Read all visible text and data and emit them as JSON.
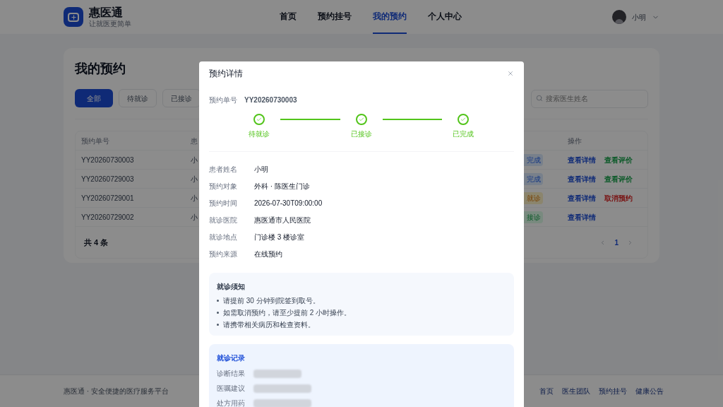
{
  "header": {
    "brand": "惠医通",
    "slogan": "让就医更简单",
    "nav": [
      {
        "label": "首页",
        "selected": false
      },
      {
        "label": "预约挂号",
        "selected": false
      },
      {
        "label": "我的预约",
        "selected": true
      },
      {
        "label": "个人中心",
        "selected": false
      }
    ],
    "user": "小明"
  },
  "page": {
    "title": "我的预约",
    "filters": [
      {
        "label": "全部",
        "selected": true
      },
      {
        "label": "待就诊",
        "selected": false
      },
      {
        "label": "已接诊",
        "selected": false
      }
    ],
    "search": {
      "placeholder": "搜索医生姓名"
    },
    "table": {
      "columns": [
        "预约单号",
        "患",
        "操作"
      ],
      "rows": [
        {
          "order_no": "YY20260730003",
          "patient": "小",
          "status": {
            "text": "完成",
            "kind": "completed"
          },
          "actions": [
            {
              "label": "查看详情",
              "kind": "detail"
            },
            {
              "label": "查看评价",
              "kind": "review"
            }
          ]
        },
        {
          "order_no": "YY20260729003",
          "patient": "小",
          "status": {
            "text": "完成",
            "kind": "completed"
          },
          "actions": [
            {
              "label": "查看详情",
              "kind": "detail"
            },
            {
              "label": "查看评价",
              "kind": "review"
            }
          ]
        },
        {
          "order_no": "YY20260729001",
          "patient": "小",
          "status": {
            "text": "就诊",
            "kind": "pending"
          },
          "actions": [
            {
              "label": "查看详情",
              "kind": "detail"
            },
            {
              "label": "取消预约",
              "kind": "cancel"
            }
          ]
        },
        {
          "order_no": "YY20260729002",
          "patient": "小",
          "status": {
            "text": "接诊",
            "kind": "visited"
          },
          "actions": [
            {
              "label": "查看详情",
              "kind": "detail"
            }
          ]
        }
      ]
    },
    "total": "共 4 条",
    "pages": [
      {
        "label": "1",
        "selected": true
      }
    ]
  },
  "footer": {
    "text": "惠医通 · 安全便捷的医疗服务平台",
    "links": [
      "首页",
      "医生团队",
      "预约挂号",
      "健康公告"
    ]
  },
  "dialog": {
    "title": "预约详情",
    "order_label": "预约单号",
    "order_no": "YY20260730003",
    "steps": [
      {
        "label": "待就诊",
        "done": true
      },
      {
        "label": "已接诊",
        "done": true
      },
      {
        "label": "已完成",
        "done": true
      }
    ],
    "fields": [
      {
        "label": "患者姓名",
        "value": "小明"
      },
      {
        "label": "预约对象",
        "value": "外科 · 陈医生门诊"
      },
      {
        "label": "预约时间",
        "value": "2026-07-30T09:00:00"
      },
      {
        "label": "就诊医院",
        "value": "惠医通市人民医院"
      },
      {
        "label": "就诊地点",
        "value": "门诊楼 3 楼诊室"
      },
      {
        "label": "预约来源",
        "value": "在线预约"
      }
    ],
    "notice": {
      "title": "就诊须知",
      "items": [
        "请提前 30 分钟到院签到取号。",
        "如需取消预约，请至少提前 2 小时操作。",
        "请携带相关病历和检查资料。"
      ]
    },
    "record": {
      "title": "就诊记录",
      "fields": [
        {
          "label": "诊断结果"
        },
        {
          "label": "医嘱建议"
        },
        {
          "label": "处方用药"
        }
      ]
    }
  }
}
